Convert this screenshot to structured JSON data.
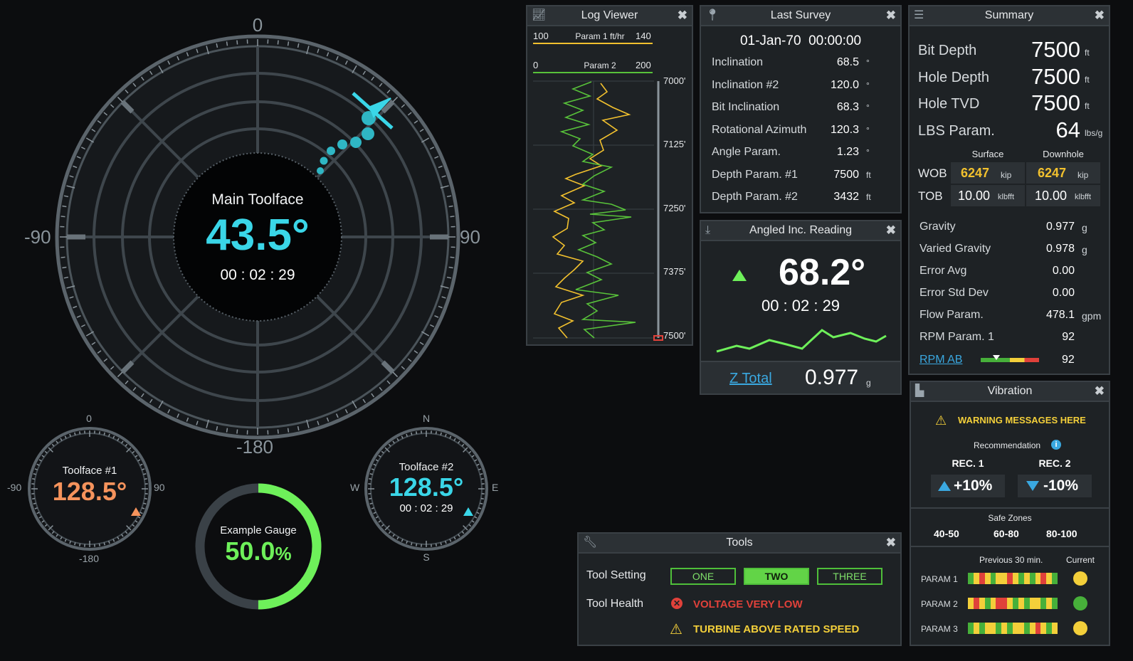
{
  "main_gauge": {
    "label": "Main Toolface",
    "value": "43.5°",
    "time": "00 : 02 : 29",
    "ticks": {
      "top": "0",
      "left": "-90",
      "right": "90",
      "bottom": "-180"
    }
  },
  "toolface1": {
    "label": "Toolface #1",
    "value": "128.5°",
    "ticks": {
      "top": "0",
      "left": "-90",
      "right": "90",
      "bottom": "-180"
    }
  },
  "toolface2": {
    "label": "Toolface #2",
    "value": "128.5°",
    "time": "00 : 02 : 29",
    "ticks": {
      "top": "N",
      "left": "W",
      "right": "E",
      "bottom": "S"
    }
  },
  "example_gauge": {
    "label": "Example Gauge",
    "value": "50.0",
    "unit": "%",
    "fraction": 0.5
  },
  "log_viewer": {
    "title": "Log Viewer",
    "param1": {
      "min": "100",
      "name": "Param 1 ft/hr",
      "max": "140",
      "color": "#f2c12e"
    },
    "param2": {
      "min": "0",
      "name": "Param 2",
      "max": "200",
      "color": "#58c23a"
    },
    "depths": [
      "7000'",
      "7125'",
      "7250'",
      "7375'",
      "7500'"
    ]
  },
  "last_survey": {
    "title": "Last Survey",
    "datetime": "01-Jan-70  00:00:00",
    "rows": [
      {
        "label": "Inclination",
        "value": "68.5",
        "unit": "°"
      },
      {
        "label": "Inclination #2",
        "value": "120.0",
        "unit": "°"
      },
      {
        "label": "Bit Inclination",
        "value": "68.3",
        "unit": "°"
      },
      {
        "label": "Rotational Azimuth",
        "value": "120.3",
        "unit": "°"
      },
      {
        "label": "Angle Param.",
        "value": "1.23",
        "unit": "°"
      },
      {
        "label": "Depth Param. #1",
        "value": "7500",
        "unit": "ft"
      },
      {
        "label": "Depth Param. #2",
        "value": "3432",
        "unit": "ft"
      }
    ]
  },
  "angled_inc": {
    "title": "Angled Inc. Reading",
    "value": "68.2°",
    "time": "00 : 02 : 29",
    "z_label": "Z Total",
    "z_value": "0.977",
    "z_unit": "g"
  },
  "summary": {
    "title": "Summary",
    "big": [
      {
        "label": "Bit Depth",
        "value": "7500",
        "unit": "ft"
      },
      {
        "label": "Hole Depth",
        "value": "7500",
        "unit": "ft"
      },
      {
        "label": "Hole TVD",
        "value": "7500",
        "unit": "ft"
      },
      {
        "label": "LBS Param.",
        "value": "64",
        "unit": "lbs/g"
      }
    ],
    "col_surface": "Surface",
    "col_downhole": "Downhole",
    "wob": {
      "label": "WOB",
      "surface": "6247",
      "downhole": "6247",
      "unit": "kip"
    },
    "tob": {
      "label": "TOB",
      "surface": "10.00",
      "downhole": "10.00",
      "unit": "klbfft"
    },
    "rows": [
      {
        "label": "Gravity",
        "value": "0.977",
        "unit": "g"
      },
      {
        "label": "Varied Gravity",
        "value": "0.978",
        "unit": "g"
      },
      {
        "label": "Error Avg",
        "value": "0.00",
        "unit": ""
      },
      {
        "label": "Error Std Dev",
        "value": "0.00",
        "unit": ""
      },
      {
        "label": "Flow Param.",
        "value": "478.1",
        "unit": "gpm"
      },
      {
        "label": "RPM Param. 1",
        "value": "92",
        "unit": ""
      }
    ],
    "rpm_ab": {
      "label": "RPM AB",
      "value": "92"
    }
  },
  "vibration": {
    "title": "Vibration",
    "warning": "WARNING MESSAGES HERE",
    "recommendation": "Recommendation",
    "rec1": {
      "label": "REC. 1",
      "value": "+10%"
    },
    "rec2": {
      "label": "REC. 2",
      "value": "-10%"
    },
    "safe_zones": "Safe Zones",
    "zones": [
      "40-50",
      "60-80",
      "80-100"
    ],
    "previous": "Previous 30 min.",
    "current": "Current",
    "params": [
      {
        "label": "PARAM 1",
        "status_color": "#f3cf3a"
      },
      {
        "label": "PARAM 2",
        "status_color": "#47b03a"
      },
      {
        "label": "PARAM 3",
        "status_color": "#f3cf3a"
      }
    ]
  },
  "tools": {
    "title": "Tools",
    "setting_label": "Tool Setting",
    "options": [
      "ONE",
      "TWO",
      "THREE"
    ],
    "selected": "TWO",
    "health_label": "Tool Health",
    "error": "VOLTAGE VERY LOW",
    "warning": "TURBINE ABOVE RATED SPEED"
  },
  "colors": {
    "cyan": "#3ad6e8",
    "orange": "#f5935c",
    "green": "#6ef05a",
    "yellow": "#f2c12e",
    "red": "#e0413a"
  }
}
